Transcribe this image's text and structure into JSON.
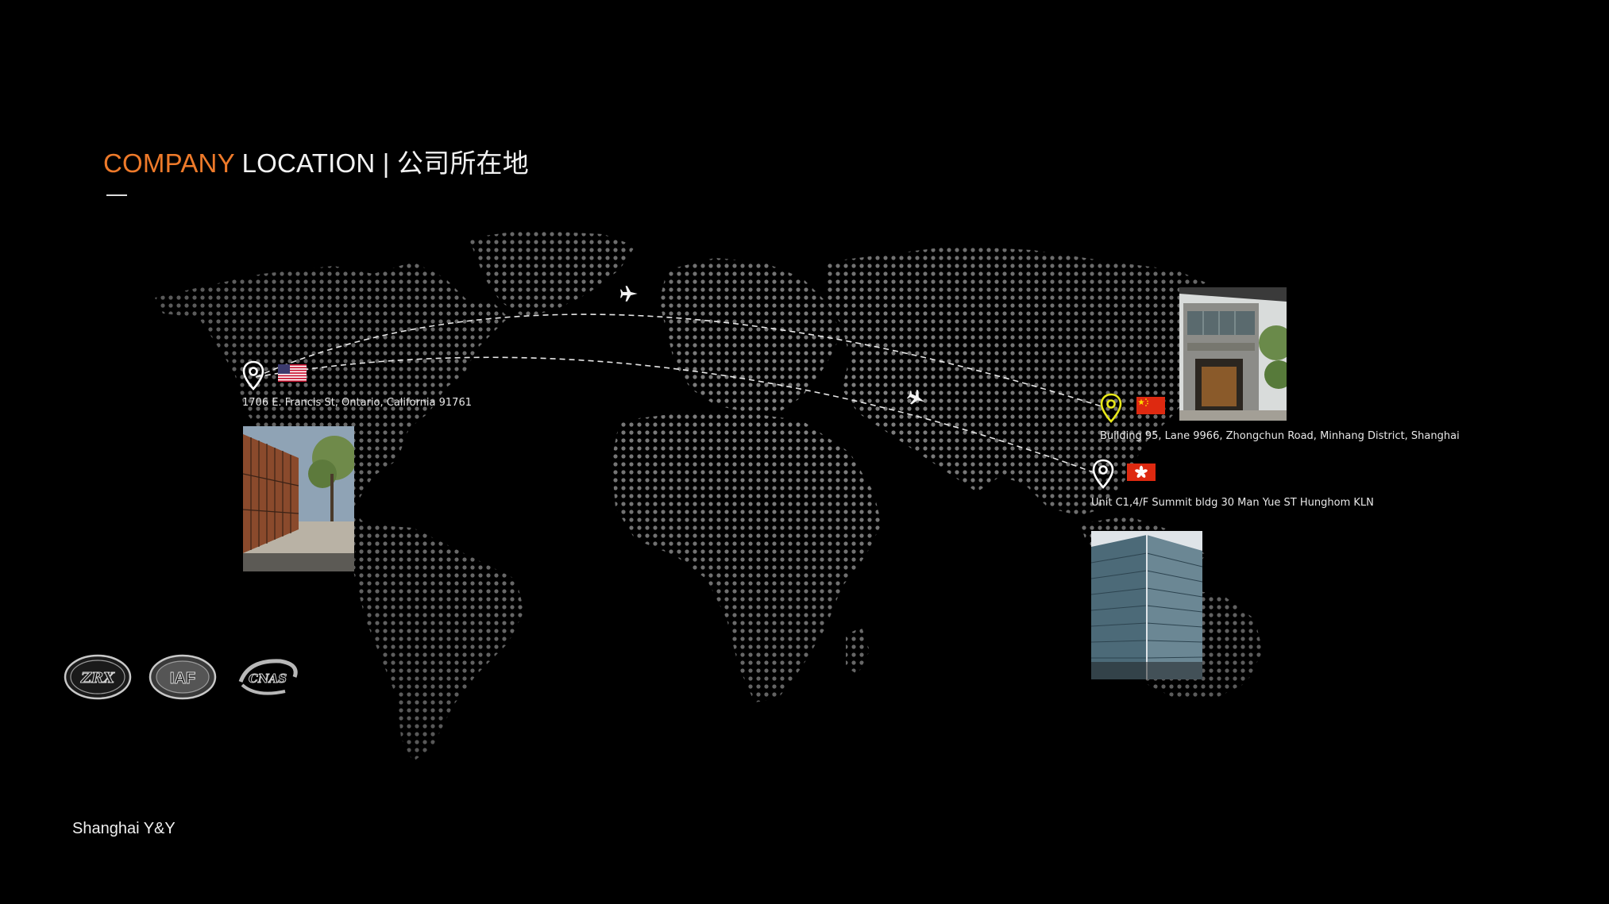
{
  "title": {
    "accent": "COMPANY",
    "main": " LOCATION | 公司所在地"
  },
  "locations": [
    {
      "id": "us",
      "address": "1706 E. Francis St, Ontario, California 91761",
      "flag": "usa-flag",
      "pin_color": "#ffffff"
    },
    {
      "id": "shanghai",
      "address": "Building 95, Lane 9966, Zhongchun Road, Minhang District, Shanghai",
      "flag": "china-flag",
      "pin_color": "#e8e81a"
    },
    {
      "id": "hongkong",
      "address": "Unit C1,4/F Summit bldg 30 Man Yue ST Hunghom KLN",
      "flag": "hong-kong-flag",
      "pin_color": "#ffffff"
    }
  ],
  "certifications": [
    {
      "name": "ZRX"
    },
    {
      "name": "IAF"
    },
    {
      "name": "CNAS"
    }
  ],
  "footer": "Shanghai Y&Y",
  "colors": {
    "accent": "#ee7a2a",
    "background": "#000000",
    "pin_highlight": "#e8e81a",
    "map_dots": "#8a8a8a"
  }
}
